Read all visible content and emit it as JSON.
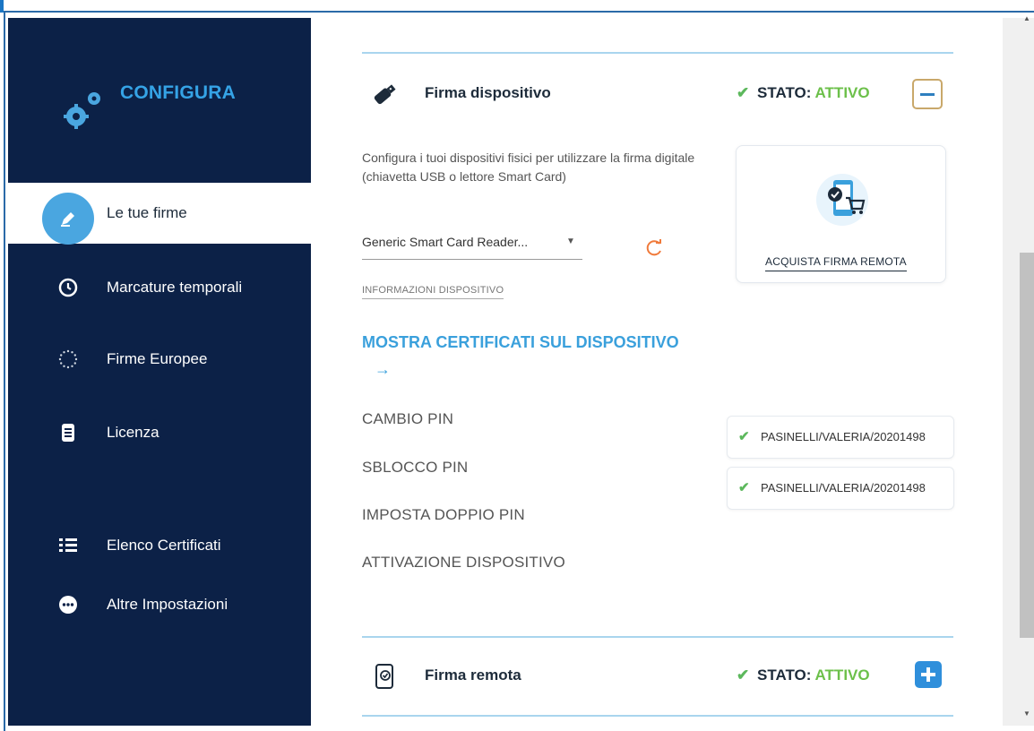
{
  "sidebar": {
    "title": "CONFIGURA",
    "items": [
      {
        "label": "Le tue firme",
        "icon": "pen-icon",
        "active": true
      },
      {
        "label": "Marcature temporali",
        "icon": "clock-icon"
      },
      {
        "label": "Firme Europee",
        "icon": "eu-stars-icon"
      },
      {
        "label": "Licenza",
        "icon": "document-icon"
      },
      {
        "label": "Elenco Certificati",
        "icon": "list-icon"
      },
      {
        "label": "Altre Impostazioni",
        "icon": "more-icon"
      }
    ]
  },
  "device_section": {
    "title": "Firma dispositivo",
    "status_label": "STATO:",
    "status_value": "ATTIVO",
    "description": "Configura i tuoi dispositivi fisici per utilizzare la firma digitale (chiavetta USB o lettore Smart Card)",
    "reader_selected": "Generic Smart Card Reader...",
    "info_link": "INFORMAZIONI DISPOSITIVO",
    "show_certs": "MOSTRA CERTIFICATI SUL DISPOSITIVO",
    "show_certs_arrow": "→",
    "actions": [
      "CAMBIO PIN",
      "SBLOCCO PIN",
      "IMPOSTA DOPPIO PIN",
      "ATTIVAZIONE DISPOSITIVO"
    ],
    "certificates": [
      "PASINELLI/VALERIA/20201498",
      "PASINELLI/VALERIA/20201498"
    ]
  },
  "promo": {
    "link": "ACQUISTA FIRMA REMOTA"
  },
  "remote_section": {
    "title": "Firma remota",
    "status_label": "STATO:",
    "status_value": "ATTIVO"
  },
  "colors": {
    "sidebar_bg": "#0c2147",
    "accent_blue": "#3aa0dc",
    "status_green": "#6cc04a"
  }
}
